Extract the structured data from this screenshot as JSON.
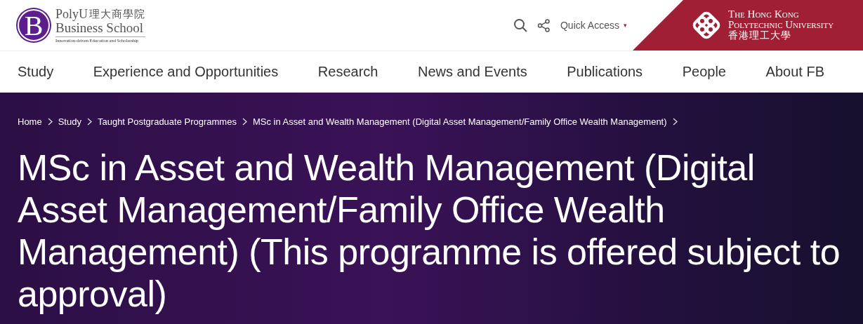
{
  "logo": {
    "letter": "B",
    "line_1": "PolyU",
    "line_1_chinese": "理大商學院",
    "line_2": "Business School",
    "tagline": "Innovation-driven Education and Scholarship"
  },
  "quick_access": {
    "label": "Quick Access",
    "caret": "▾"
  },
  "university": {
    "line_1": "The Hong Kong",
    "line_2": "Polytechnic University",
    "chinese": "香港理工大學"
  },
  "nav": [
    {
      "label": "Study"
    },
    {
      "label": "Experience and Opportunities"
    },
    {
      "label": "Research"
    },
    {
      "label": "News and Events"
    },
    {
      "label": "Publications"
    },
    {
      "label": "People"
    },
    {
      "label": "About FB"
    }
  ],
  "breadcrumbs": [
    {
      "label": "Home"
    },
    {
      "label": "Study"
    },
    {
      "label": "Taught Postgraduate Programmes"
    },
    {
      "label": "MSc in Asset and Wealth Management (Digital Asset Management/Family Office Wealth Management)"
    }
  ],
  "title": "MSc in Asset and Wealth Management (Digital Asset Management/Family Office Wealth Management) (This programme is offered subject to approval)"
}
